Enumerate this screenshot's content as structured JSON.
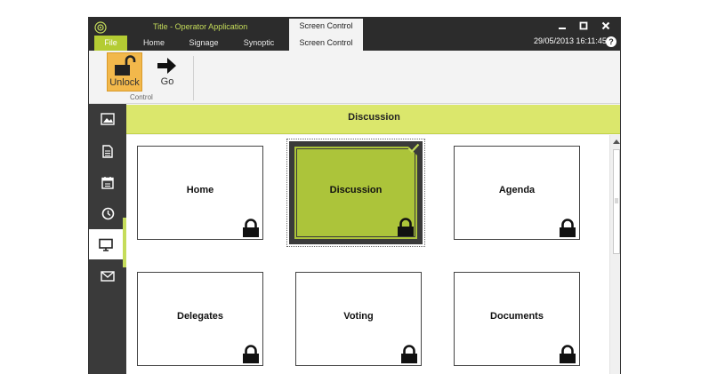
{
  "titlebar": {
    "app_title": "Title - Operator Application",
    "context_tab": "Screen Control",
    "file_tab": "File",
    "tabs": [
      {
        "label": "Home"
      },
      {
        "label": "Signage"
      },
      {
        "label": "Synoptic"
      },
      {
        "label": "Screen Control"
      }
    ],
    "datetime": "29/05/2013 16:11:45",
    "help": "?",
    "minimize": "✕",
    "close": "✕"
  },
  "ribbon": {
    "unlock_label": "Unlock",
    "go_label": "Go",
    "group_label": "Control"
  },
  "sidebar": {
    "icons": [
      "image-icon",
      "document-icon",
      "calendar-icon",
      "clock-icon",
      "monitor-icon",
      "mail-icon"
    ]
  },
  "content": {
    "header": "Discussion",
    "cards": [
      {
        "label": "Home",
        "selected": false
      },
      {
        "label": "Discussion",
        "selected": true
      },
      {
        "label": "Agenda",
        "selected": false
      },
      {
        "label": "Delegates",
        "selected": false
      },
      {
        "label": "Voting",
        "selected": false
      },
      {
        "label": "Documents",
        "selected": false
      }
    ]
  },
  "colors": {
    "accent": "#c5dc5a",
    "header_bg": "#dbe76c",
    "selected_card": "#acc43a",
    "dark": "#2c2c2c",
    "unlock_active": "#f2b84b"
  }
}
